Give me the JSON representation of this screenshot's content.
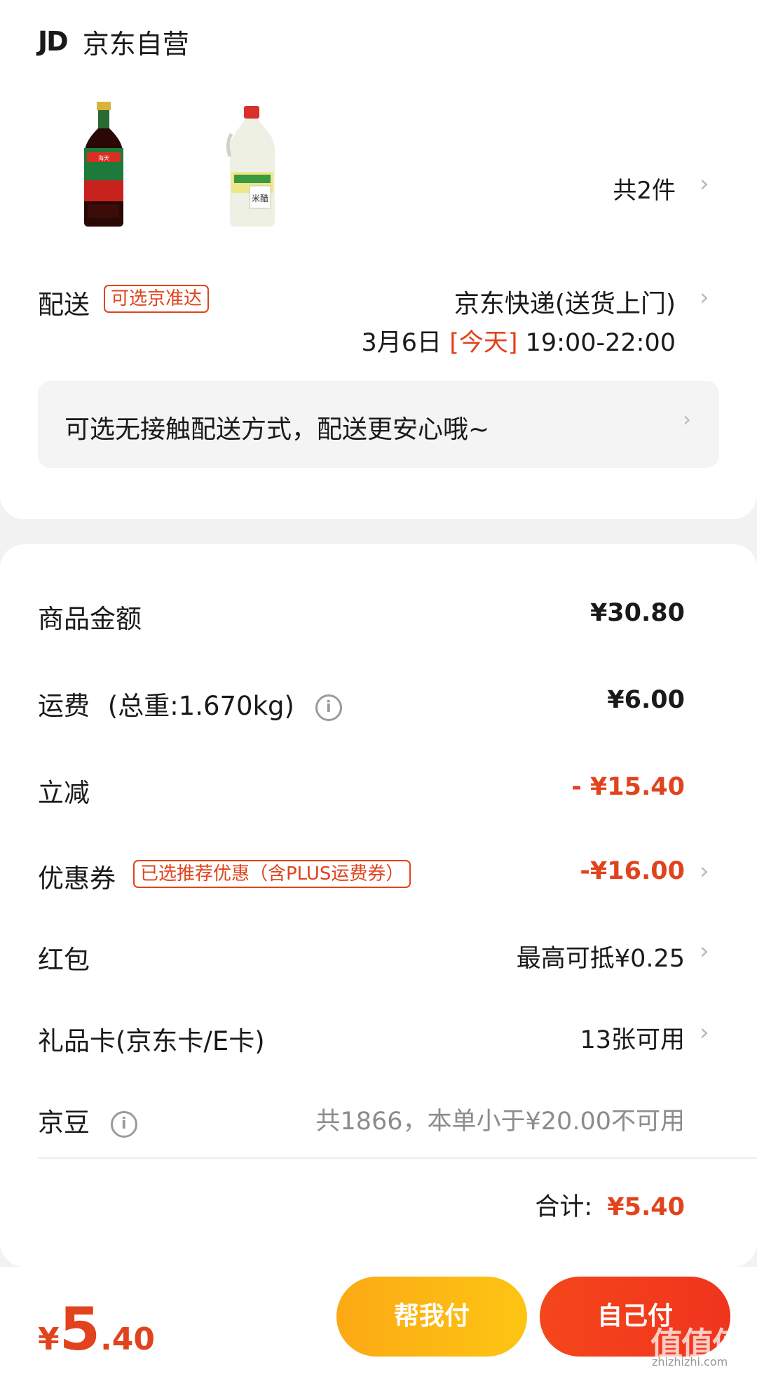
{
  "store": {
    "logo": "JD",
    "name": "京东自营"
  },
  "products": {
    "items": [
      {
        "name": "soy-sauce-bottle",
        "color": "#c8221e"
      },
      {
        "name": "rice-vinegar-jug",
        "color": "#dcdcb4"
      }
    ],
    "count_label": "共2件"
  },
  "delivery": {
    "label": "配送",
    "tag": "可选京准达",
    "method": "京东快递(送货上门)",
    "date": "3月6日",
    "today": "[今天]",
    "time": "19:00-22:00",
    "notice": "可选无接触配送方式，配送更安心哦~"
  },
  "summary": {
    "goods_amount": {
      "label": "商品金额",
      "value": "¥30.80"
    },
    "shipping": {
      "label": "运费",
      "weight": "(总重:1.670kg)",
      "value": "¥6.00"
    },
    "instant_discount": {
      "label": "立减",
      "value": "- ¥15.40"
    },
    "coupon": {
      "label": "优惠券",
      "tag": "已选推荐优惠（含PLUS运费券）",
      "value": "-¥16.00"
    },
    "red_packet": {
      "label": "红包",
      "value": "最高可抵¥0.25"
    },
    "gift_card": {
      "label": "礼品卡(京东卡/E卡)",
      "value": "13张可用"
    },
    "jingdou": {
      "label": "京豆",
      "value": "共1866，本单小于¥20.00不可用"
    },
    "total": {
      "label": "合计:",
      "value": "¥5.40"
    }
  },
  "footer": {
    "currency": "¥",
    "price_int": "5",
    "price_dec": ".40",
    "help_pay": "帮我付",
    "self_pay": "自己付"
  },
  "watermark": {
    "main": "值值值",
    "sub": "zhizhizhi.com"
  },
  "colors": {
    "accent_red": "#e0431d",
    "help_btn": "#fca914",
    "self_btn": "#f0341d"
  }
}
